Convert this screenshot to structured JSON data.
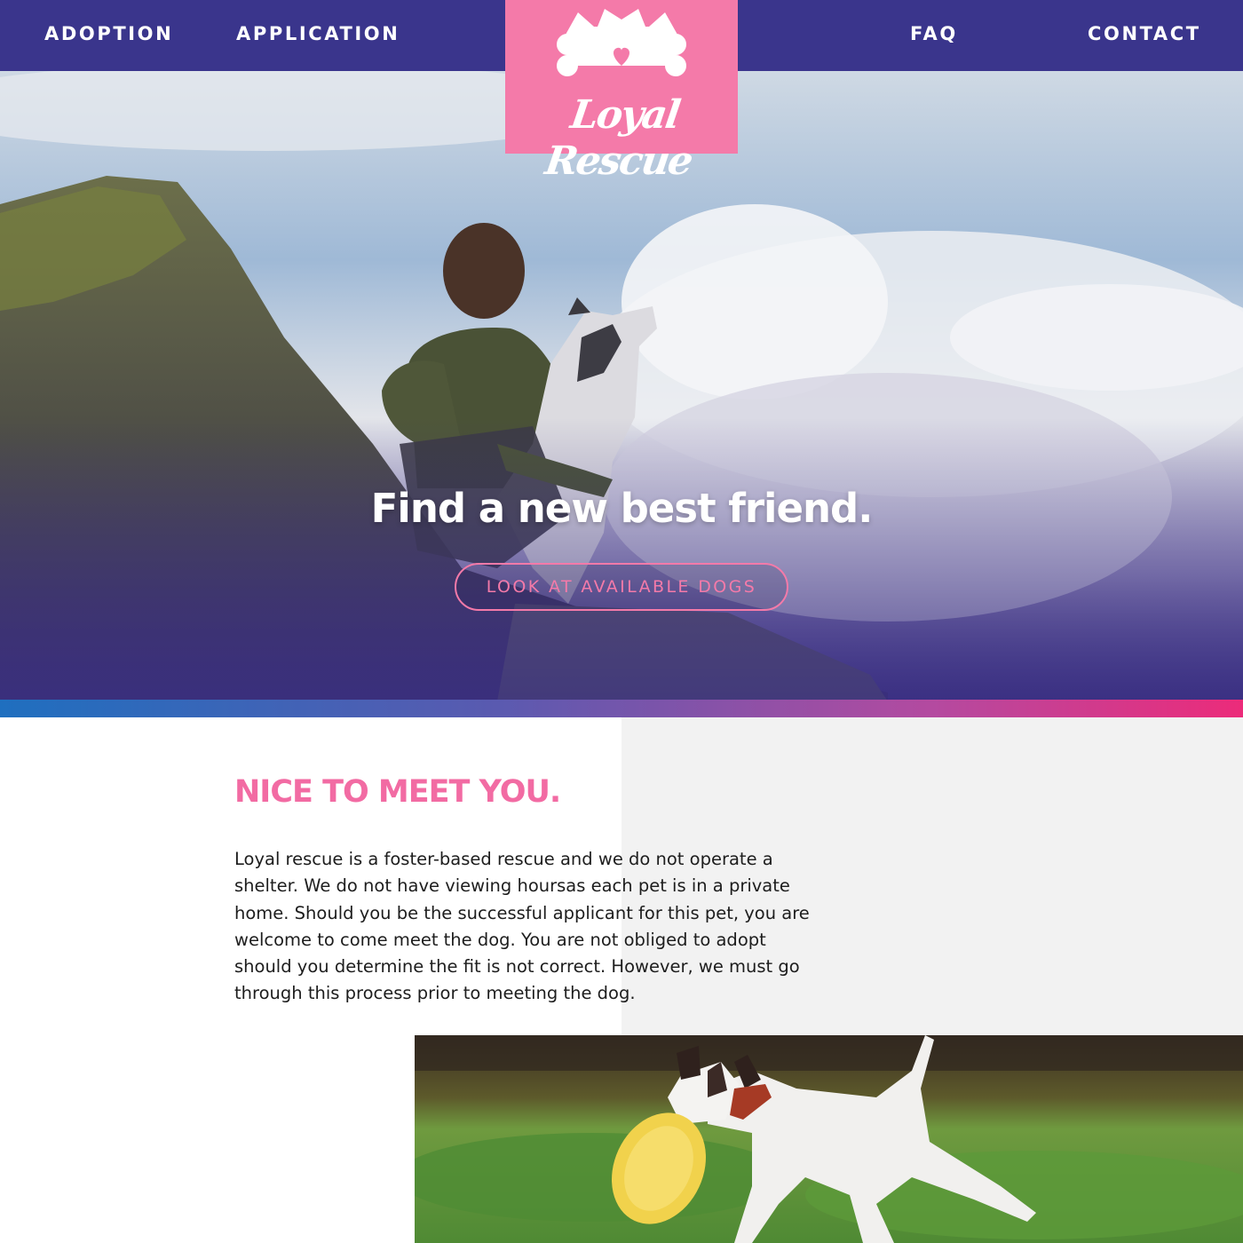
{
  "nav": {
    "left": [
      {
        "label": "ADOPTION"
      },
      {
        "label": "APPLICATION"
      }
    ],
    "right": [
      {
        "label": "FAQ"
      },
      {
        "label": "CONTACT"
      }
    ]
  },
  "logo": {
    "text": "Loyal Rescue",
    "icon": "dog-bone-heart-icon"
  },
  "hero": {
    "title": "Find a new best friend.",
    "button_label": "LOOK AT AVAILABLE DOGS"
  },
  "about": {
    "title": "NICE TO MEET YOU.",
    "body": "Loyal rescue is a foster-based rescue and we do not operate a shelter. We do not have viewing hoursas each pet is in a private home. Should you be the successful applicant for this pet, you are welcome to come meet the dog. You are not obliged to adopt should you determine the fit is not correct. However, we must go through this process prior to meeting the dog."
  },
  "colors": {
    "nav_bg": "#3a358c",
    "brand_pink": "#f47aa9",
    "heading_pink": "#f26ba3",
    "gradient_start": "#1f6fbf",
    "gradient_end": "#ec2b7a",
    "section_grey": "#f2f2f2"
  }
}
